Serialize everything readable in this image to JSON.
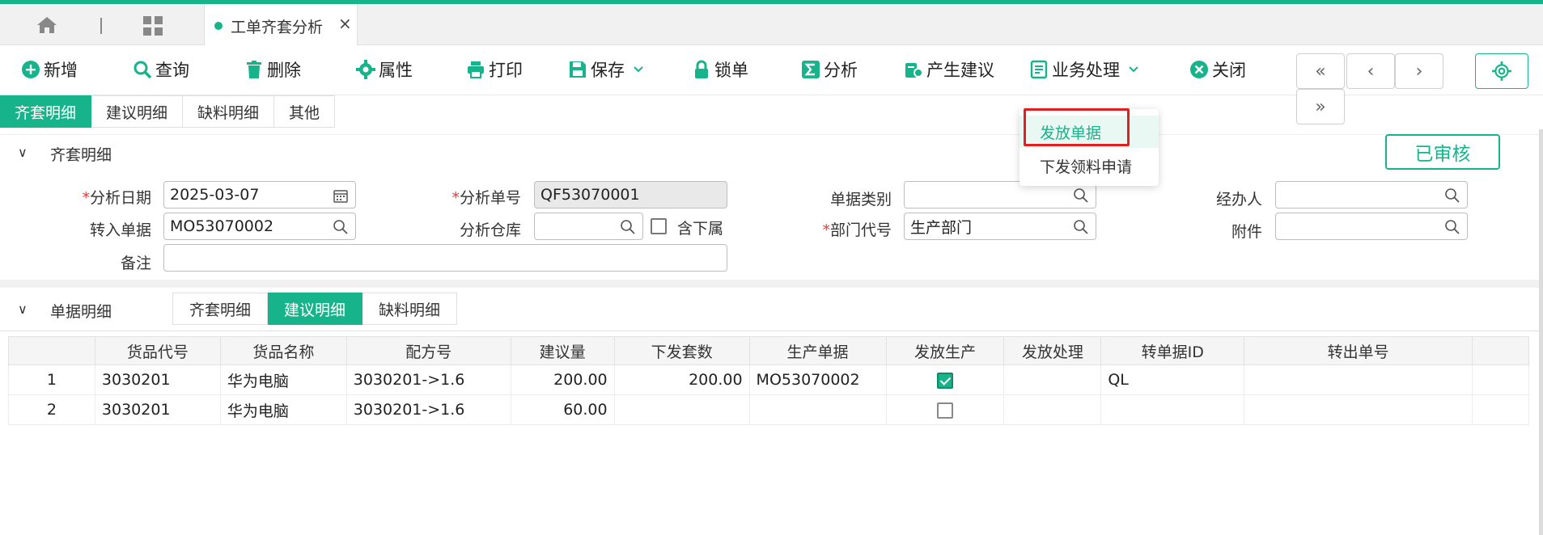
{
  "tabs": {
    "active_label": "工单齐套分析",
    "close": "×"
  },
  "toolbar": {
    "add": "新增",
    "query": "查询",
    "delete": "删除",
    "properties": "属性",
    "print": "打印",
    "save": "保存",
    "lock": "锁单",
    "analyze": "分析",
    "suggest": "产生建议",
    "business": "业务处理",
    "close": "关闭",
    "nav_first": "«",
    "nav_prev": "‹",
    "nav_next": "›",
    "nav_last": "»"
  },
  "subtabs": [
    "齐套明细",
    "建议明细",
    "缺料明细",
    "其他"
  ],
  "header_section": {
    "title": "齐套明细",
    "status": "已审核"
  },
  "form": {
    "analysis_date_label": "分析日期",
    "analysis_date": "2025-03-07",
    "analysis_no_label": "分析单号",
    "analysis_no": "QF53070001",
    "doc_type_label": "单据类别",
    "doc_type": "",
    "handler_label": "经办人",
    "handler": "",
    "transfer_doc_label": "转入单据",
    "transfer_doc": "MO53070002",
    "warehouse_label": "分析仓库",
    "warehouse": "",
    "include_sub_label": "含下属",
    "dept_label": "部门代号",
    "dept": "生产部门",
    "attachment_label": "附件",
    "attachment": "",
    "remark_label": "备注",
    "remark": ""
  },
  "detail_section": {
    "title": "单据明细",
    "tabs": [
      "齐套明细",
      "建议明细",
      "缺料明细"
    ]
  },
  "table": {
    "headers": [
      "",
      "货品代号",
      "货品名称",
      "配方号",
      "建议量",
      "下发套数",
      "生产单据",
      "发放生产",
      "发放处理",
      "转单据ID",
      "转出单号"
    ],
    "rows": [
      {
        "idx": "1",
        "code": "3030201",
        "name": "华为电脑",
        "formula": "3030201->1.6",
        "qty": "200.00",
        "sets": "200.00",
        "order": "MO53070002",
        "release": true,
        "process": "",
        "doc_id": "QL",
        "out_no": ""
      },
      {
        "idx": "2",
        "code": "3030201",
        "name": "华为电脑",
        "formula": "3030201->1.6",
        "qty": "60.00",
        "sets": "",
        "order": "",
        "release": false,
        "process": "",
        "doc_id": "",
        "out_no": ""
      }
    ]
  },
  "dropdown": {
    "items": [
      "发放单据",
      "下发领料申请"
    ]
  },
  "colors": {
    "accent": "#17b38a",
    "highlight": "#e02020"
  }
}
